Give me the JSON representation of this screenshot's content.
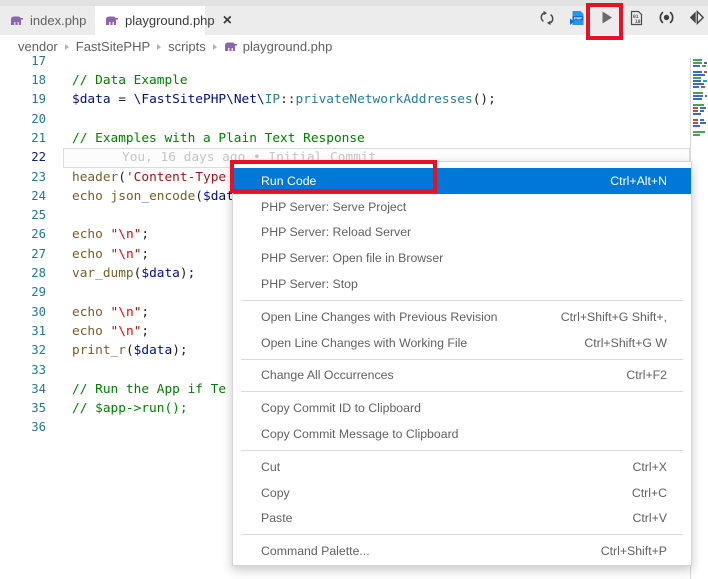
{
  "colors": {
    "accent": "#0078d7",
    "annotation_red": "#e81123",
    "comment_green": "#008000",
    "variable_blue": "#001080",
    "function_brown": "#795E26",
    "string_red": "#a31515",
    "class_teal": "#267f99",
    "line_number": "#237893"
  },
  "tabs": [
    {
      "label": "index.php",
      "active": false
    },
    {
      "label": "playground.php",
      "active": true,
      "close_glyph": "×"
    }
  ],
  "toolbar": {
    "icons": [
      "sync",
      "php-server-run",
      "run-file",
      "binary-file",
      "preview",
      "split-editor"
    ]
  },
  "breadcrumb": {
    "items": [
      "vendor",
      "FastSitePHP",
      "scripts"
    ],
    "file": "playground.php"
  },
  "editor": {
    "blame_text": "You, 16 days ago • Initial Commit",
    "lines": [
      {
        "num": "17",
        "tokens": []
      },
      {
        "num": "18",
        "tokens": [
          {
            "c": "com",
            "t": "// Data Example"
          }
        ]
      },
      {
        "num": "19",
        "tokens": [
          {
            "c": "var",
            "t": "$data"
          },
          {
            "c": "op",
            "t": " = "
          },
          {
            "c": "var",
            "t": "\\FastSitePHP\\Net\\"
          },
          {
            "c": "cls",
            "t": "IP"
          },
          {
            "c": "op",
            "t": "::"
          },
          {
            "c": "cls",
            "t": "privateNetworkAddresses"
          },
          {
            "c": "op",
            "t": "();"
          }
        ]
      },
      {
        "num": "20",
        "tokens": []
      },
      {
        "num": "21",
        "tokens": [
          {
            "c": "com",
            "t": "// Examples with a Plain Text Response"
          }
        ]
      },
      {
        "num": "22",
        "tokens": [],
        "blame": true,
        "current": true
      },
      {
        "num": "23",
        "tokens": [
          {
            "c": "func",
            "t": "header"
          },
          {
            "c": "op",
            "t": "("
          },
          {
            "c": "str",
            "t": "'Content-Type"
          }
        ]
      },
      {
        "num": "24",
        "tokens": [
          {
            "c": "func",
            "t": "echo"
          },
          {
            "c": "op",
            "t": " "
          },
          {
            "c": "func",
            "t": "json_encode"
          },
          {
            "c": "op",
            "t": "("
          },
          {
            "c": "var",
            "t": "$dat"
          }
        ]
      },
      {
        "num": "25",
        "tokens": []
      },
      {
        "num": "26",
        "tokens": [
          {
            "c": "func",
            "t": "echo"
          },
          {
            "c": "op",
            "t": " "
          },
          {
            "c": "str",
            "t": "\""
          },
          {
            "c": "esc",
            "t": "\\n"
          },
          {
            "c": "str",
            "t": "\""
          },
          {
            "c": "op",
            "t": ";"
          }
        ]
      },
      {
        "num": "27",
        "tokens": [
          {
            "c": "func",
            "t": "echo"
          },
          {
            "c": "op",
            "t": " "
          },
          {
            "c": "str",
            "t": "\""
          },
          {
            "c": "esc",
            "t": "\\n"
          },
          {
            "c": "str",
            "t": "\""
          },
          {
            "c": "op",
            "t": ";"
          }
        ]
      },
      {
        "num": "28",
        "tokens": [
          {
            "c": "func",
            "t": "var_dump"
          },
          {
            "c": "op",
            "t": "("
          },
          {
            "c": "var",
            "t": "$data"
          },
          {
            "c": "op",
            "t": ");"
          }
        ]
      },
      {
        "num": "29",
        "tokens": []
      },
      {
        "num": "30",
        "tokens": [
          {
            "c": "func",
            "t": "echo"
          },
          {
            "c": "op",
            "t": " "
          },
          {
            "c": "str",
            "t": "\""
          },
          {
            "c": "esc",
            "t": "\\n"
          },
          {
            "c": "str",
            "t": "\""
          },
          {
            "c": "op",
            "t": ";"
          }
        ]
      },
      {
        "num": "31",
        "tokens": [
          {
            "c": "func",
            "t": "echo"
          },
          {
            "c": "op",
            "t": " "
          },
          {
            "c": "str",
            "t": "\""
          },
          {
            "c": "esc",
            "t": "\\n"
          },
          {
            "c": "str",
            "t": "\""
          },
          {
            "c": "op",
            "t": ";"
          }
        ]
      },
      {
        "num": "32",
        "tokens": [
          {
            "c": "func",
            "t": "print_r"
          },
          {
            "c": "op",
            "t": "("
          },
          {
            "c": "var",
            "t": "$data"
          },
          {
            "c": "op",
            "t": ");"
          }
        ]
      },
      {
        "num": "33",
        "tokens": []
      },
      {
        "num": "34",
        "tokens": [
          {
            "c": "com",
            "t": "// Run the App if Te"
          }
        ]
      },
      {
        "num": "35",
        "tokens": [
          {
            "c": "com",
            "t": "// $app->run();"
          }
        ]
      },
      {
        "num": "36",
        "tokens": []
      }
    ]
  },
  "minimap": [
    [
      {
        "c": "g",
        "w": 9
      }
    ],
    [
      {
        "c": "g",
        "w": 11
      },
      {
        "c": "b",
        "w": 3
      }
    ],
    [
      {
        "c": "b",
        "w": 7
      },
      {
        "c": "g",
        "w": 4
      }
    ],
    [],
    [
      {
        "c": "b",
        "w": 10
      },
      {
        "c": "r",
        "w": 3
      }
    ],
    [
      {
        "c": "b",
        "w": 12
      }
    ],
    [
      {
        "c": "g",
        "w": 8
      }
    ],
    [
      {
        "c": "b",
        "w": 9
      },
      {
        "c": "t",
        "w": 4
      }
    ],
    [
      {
        "c": "b",
        "w": 11
      }
    ],
    [
      {
        "c": "b",
        "w": 6
      },
      {
        "c": "r",
        "w": 4
      }
    ],
    [],
    [
      {
        "c": "g",
        "w": 10
      }
    ],
    [
      {
        "c": "b",
        "w": 12
      },
      {
        "c": "b",
        "w": 2
      }
    ],
    [
      {
        "c": "b",
        "w": 9
      }
    ],
    [],
    [
      {
        "c": "g",
        "w": 11
      }
    ],
    [
      {
        "c": "r",
        "w": 5
      },
      {
        "c": "b",
        "w": 6
      }
    ],
    [
      {
        "c": "r",
        "w": 5
      },
      {
        "c": "b",
        "w": 4
      }
    ],
    [
      {
        "c": "b",
        "w": 8
      }
    ],
    [],
    [
      {
        "c": "r",
        "w": 5
      },
      {
        "c": "b",
        "w": 4
      }
    ],
    [
      {
        "c": "r",
        "w": 5
      },
      {
        "c": "b",
        "w": 6
      }
    ],
    [
      {
        "c": "b",
        "w": 7
      }
    ],
    [],
    [
      {
        "c": "g",
        "w": 12
      }
    ],
    [
      {
        "c": "g",
        "w": 7
      }
    ]
  ],
  "context_menu": {
    "groups": [
      {
        "items": [
          {
            "label": "Run Code",
            "shortcut": "Ctrl+Alt+N",
            "highlighted": true
          },
          {
            "label": "PHP Server: Serve Project"
          },
          {
            "label": "PHP Server: Reload Server"
          },
          {
            "label": "PHP Server: Open file in Browser"
          },
          {
            "label": "PHP Server: Stop"
          }
        ]
      },
      {
        "items": [
          {
            "label": "Open Line Changes with Previous Revision",
            "shortcut": "Ctrl+Shift+G Shift+,"
          },
          {
            "label": "Open Line Changes with Working File",
            "shortcut": "Ctrl+Shift+G W"
          }
        ]
      },
      {
        "items": [
          {
            "label": "Change All Occurrences",
            "shortcut": "Ctrl+F2"
          }
        ]
      },
      {
        "items": [
          {
            "label": "Copy Commit ID to Clipboard"
          },
          {
            "label": "Copy Commit Message to Clipboard"
          }
        ]
      },
      {
        "items": [
          {
            "label": "Cut",
            "shortcut": "Ctrl+X"
          },
          {
            "label": "Copy",
            "shortcut": "Ctrl+C"
          },
          {
            "label": "Paste",
            "shortcut": "Ctrl+V"
          }
        ]
      },
      {
        "items": [
          {
            "label": "Command Palette...",
            "shortcut": "Ctrl+Shift+P"
          }
        ]
      }
    ]
  }
}
